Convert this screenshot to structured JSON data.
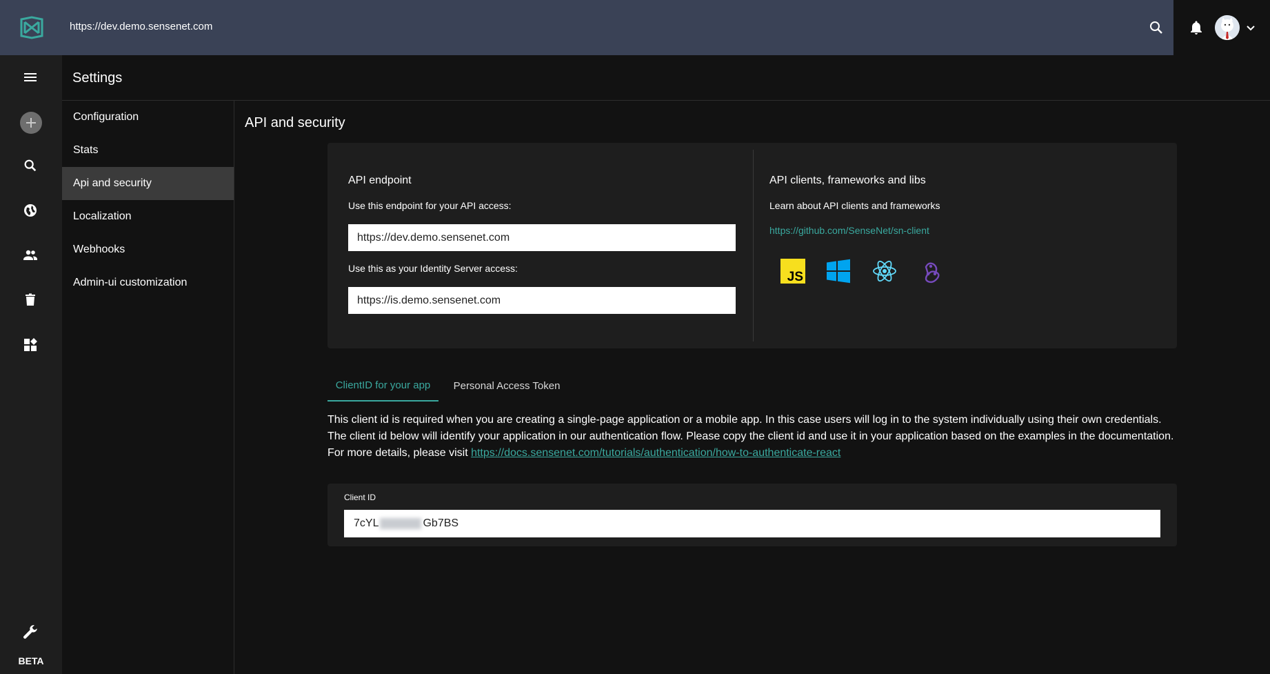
{
  "topbar": {
    "url": "https://dev.demo.sensenet.com"
  },
  "sidebar": {
    "beta_label": "BETA"
  },
  "settings": {
    "title": "Settings",
    "menu": [
      {
        "label": "Configuration"
      },
      {
        "label": "Stats"
      },
      {
        "label": "Api and security"
      },
      {
        "label": "Localization"
      },
      {
        "label": "Webhooks"
      },
      {
        "label": "Admin-ui customization"
      }
    ]
  },
  "main": {
    "title": "API and security",
    "api_endpoint": {
      "heading": "API endpoint",
      "endpoint_hint": "Use this endpoint for your API access:",
      "endpoint_value": "https://dev.demo.sensenet.com",
      "identity_hint": "Use this as your Identity Server access:",
      "identity_value": "https://is.demo.sensenet.com"
    },
    "clients": {
      "heading": "API clients, frameworks and libs",
      "text": "Learn about API clients and frameworks",
      "link": "https://github.com/SenseNet/sn-client",
      "icons": [
        "javascript-icon",
        "windows-icon",
        "react-icon",
        "redux-icon"
      ],
      "colors": {
        "js": "#f7df1e",
        "windows": "#00a4ef",
        "react": "#61dafb",
        "redux": "#764abc"
      }
    },
    "tabs": [
      {
        "label": "ClientID for your app"
      },
      {
        "label": "Personal Access Token"
      }
    ],
    "description": "This client id is required when you are creating a single-page application or a mobile app. In this case users will log in to the system individually using their own credentials. The client id below will identify your application in our authentication flow. Please copy the client id and use it in your application based on the examples in the documentation. For more details, please visit ",
    "docs_link": "https://docs.sensenet.com/tutorials/authentication/how-to-authenticate-react",
    "client_id": {
      "label": "Client ID",
      "value_start": "7cYL",
      "value_end": "Gb7BS"
    }
  },
  "theme": {
    "accent": "#3aa99f",
    "topbar": "#3a4256",
    "background": "#121212",
    "surface": "#1e1e1e"
  }
}
